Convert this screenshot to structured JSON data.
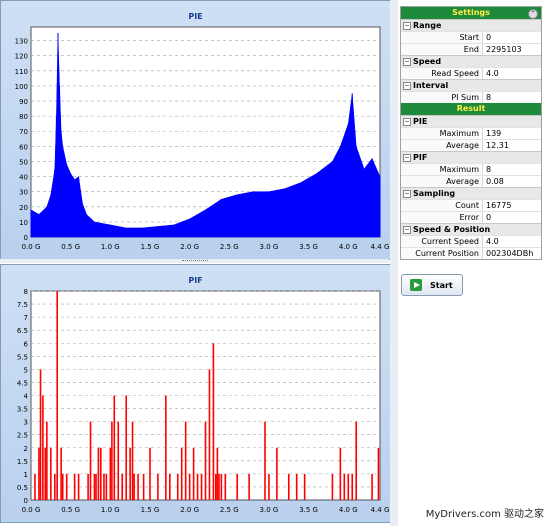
{
  "charts": [
    {
      "id": "pie",
      "title": "PIE",
      "bar_color": "#0000ff",
      "y_ticks": [
        "130",
        "120",
        "110",
        "100",
        "90",
        "80",
        "70",
        "60",
        "50",
        "40",
        "30",
        "20",
        "10",
        "0"
      ],
      "y_max": 139,
      "x_ticks": [
        "0.0 G",
        "0.5 G",
        "1.0 G",
        "1.5 G",
        "2.0 G",
        "2.5 G",
        "3.0 G",
        "3.5 G",
        "4.0 G",
        "4.4 G"
      ],
      "x_max": 4.4
    },
    {
      "id": "pif",
      "title": "PIF",
      "bar_color": "#ff0000",
      "y_ticks": [
        "8",
        "7.5",
        "7",
        "6.5",
        "6",
        "5.5",
        "5",
        "4.5",
        "4",
        "3.5",
        "3",
        "2.5",
        "2",
        "1.5",
        "1",
        "0.5",
        "0"
      ],
      "y_max": 8,
      "x_ticks": [
        "0.0 G",
        "0.5 G",
        "1.0 G",
        "1.5 G",
        "2.0 G",
        "2.5 G",
        "3.0 G",
        "3.5 G",
        "4.0 G",
        "4.4 G"
      ],
      "x_max": 4.4
    }
  ],
  "chart_data": [
    {
      "type": "area",
      "title": "PIE",
      "xlabel": "",
      "ylabel": "",
      "xlim": [
        0,
        4.4
      ],
      "ylim": [
        0,
        139
      ],
      "x": [
        0.0,
        0.1,
        0.2,
        0.25,
        0.3,
        0.32,
        0.34,
        0.36,
        0.38,
        0.4,
        0.45,
        0.5,
        0.55,
        0.6,
        0.65,
        0.7,
        0.8,
        1.0,
        1.2,
        1.4,
        1.6,
        1.8,
        2.0,
        2.2,
        2.4,
        2.6,
        2.8,
        3.0,
        3.2,
        3.4,
        3.6,
        3.8,
        3.9,
        4.0,
        4.05,
        4.1,
        4.2,
        4.3,
        4.4
      ],
      "y": [
        18,
        15,
        20,
        28,
        45,
        80,
        135,
        100,
        70,
        60,
        48,
        42,
        38,
        40,
        22,
        15,
        10,
        8,
        6,
        6,
        7,
        8,
        12,
        18,
        25,
        28,
        30,
        30,
        32,
        36,
        42,
        50,
        60,
        75,
        95,
        60,
        45,
        52,
        40
      ]
    },
    {
      "type": "bar",
      "title": "PIF",
      "xlabel": "",
      "ylabel": "",
      "xlim": [
        0,
        4.4
      ],
      "ylim": [
        0,
        8
      ],
      "x": [
        0.05,
        0.1,
        0.12,
        0.15,
        0.18,
        0.2,
        0.25,
        0.3,
        0.33,
        0.38,
        0.4,
        0.45,
        0.55,
        0.6,
        0.72,
        0.75,
        0.8,
        0.82,
        0.85,
        0.88,
        0.92,
        0.95,
        1.0,
        1.02,
        1.05,
        1.1,
        1.15,
        1.2,
        1.25,
        1.28,
        1.3,
        1.35,
        1.42,
        1.5,
        1.6,
        1.7,
        1.75,
        1.85,
        1.9,
        1.95,
        2.0,
        2.05,
        2.1,
        2.15,
        2.2,
        2.25,
        2.3,
        2.33,
        2.35,
        2.37,
        2.4,
        2.45,
        2.6,
        2.75,
        2.95,
        3.0,
        3.1,
        3.25,
        3.35,
        3.45,
        3.8,
        3.9,
        3.95,
        4.0,
        4.05,
        4.1,
        4.3,
        4.38
      ],
      "y": [
        1,
        2,
        5,
        4,
        2,
        3,
        2,
        1,
        8,
        2,
        1,
        1,
        1,
        1,
        1,
        3,
        1,
        1,
        2,
        2,
        1,
        1,
        2,
        3,
        4,
        3,
        1,
        4,
        2,
        3,
        1,
        1,
        1,
        2,
        1,
        4,
        1,
        1,
        2,
        3,
        1,
        2,
        1,
        1,
        3,
        5,
        6,
        1,
        2,
        1,
        1,
        1,
        1,
        1,
        3,
        1,
        2,
        1,
        1,
        1,
        1,
        2,
        1,
        1,
        1,
        3,
        1,
        2
      ]
    }
  ],
  "settings": {
    "header": "Settings",
    "sections": [
      {
        "name": "Range",
        "rows": [
          {
            "key": "Start",
            "value": "0"
          },
          {
            "key": "End",
            "value": "2295103"
          }
        ]
      },
      {
        "name": "Speed",
        "rows": [
          {
            "key": "Read Speed",
            "value": "4.0"
          }
        ]
      },
      {
        "name": "Interval",
        "rows": [
          {
            "key": "PI Sum",
            "value": "8"
          }
        ]
      }
    ]
  },
  "result": {
    "header": "Result",
    "sections": [
      {
        "name": "PIE",
        "rows": [
          {
            "key": "Maximum",
            "value": "139"
          },
          {
            "key": "Average",
            "value": "12.31"
          }
        ]
      },
      {
        "name": "PIF",
        "rows": [
          {
            "key": "Maximum",
            "value": "8"
          },
          {
            "key": "Average",
            "value": "0.08"
          }
        ]
      },
      {
        "name": "Sampling",
        "rows": [
          {
            "key": "Count",
            "value": "16775"
          },
          {
            "key": "Error",
            "value": "0"
          }
        ]
      },
      {
        "name": "Speed & Position",
        "rows": [
          {
            "key": "Current Speed",
            "value": "4.0"
          },
          {
            "key": "Current Position",
            "value": "002304DBh"
          }
        ]
      }
    ]
  },
  "start_button": {
    "label": "Start"
  },
  "watermark": "MyDrivers.com 驱动之家",
  "colors": {
    "header_bg": "#1e8a3c",
    "header_text": "#ffee44"
  }
}
